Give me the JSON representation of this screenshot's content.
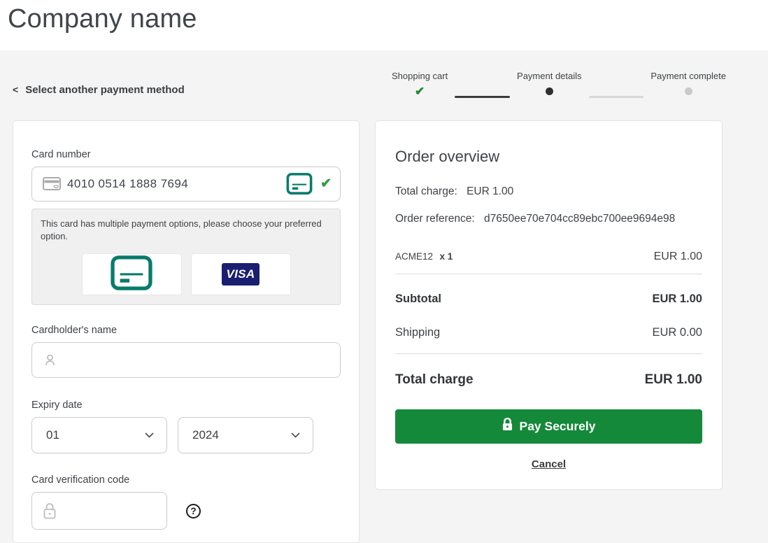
{
  "header": {
    "title": "Company name"
  },
  "back_link": {
    "arrow": "<",
    "label": "Select another payment method"
  },
  "stepper": {
    "steps": [
      {
        "label": "Shopping cart",
        "state": "complete"
      },
      {
        "label": "Payment details",
        "state": "active"
      },
      {
        "label": "Payment complete",
        "state": "upcoming"
      }
    ]
  },
  "card_form": {
    "card_number_label": "Card number",
    "card_number_value": "4010 0514 1888 7694",
    "notice_text": "This card has multiple payment options, please choose your preferred option.",
    "visa_text": "VISA",
    "cardholder_label": "Cardholder's name",
    "cardholder_value": "",
    "expiry_label": "Expiry date",
    "expiry_month": "01",
    "expiry_year": "2024",
    "cvc_label": "Card verification code",
    "cvc_value": ""
  },
  "order": {
    "title": "Order overview",
    "total_charge_label": "Total charge:",
    "total_charge_value": "EUR 1.00",
    "reference_label": "Order reference:",
    "reference_value": "d7650ee70e704cc89ebc700ee9694e98",
    "item": {
      "name": "ACME12",
      "qty": "x 1",
      "amount": "EUR 1.00"
    },
    "subtotal_label": "Subtotal",
    "subtotal_value": "EUR 1.00",
    "shipping_label": "Shipping",
    "shipping_value": "EUR 0.00",
    "total_label": "Total charge",
    "total_value": "EUR 1.00",
    "pay_button_label": "Pay Securely",
    "cancel_label": "Cancel"
  },
  "icons": {
    "check": "✔",
    "help": "?"
  },
  "colors": {
    "page_background": "#f4f4f4",
    "accent_green": "#14893a",
    "check_green": "#2f9e41",
    "stepper_green": "#1f8b2c",
    "card_brand_teal": "#077b6c",
    "visa_navy": "#1a1f71"
  }
}
